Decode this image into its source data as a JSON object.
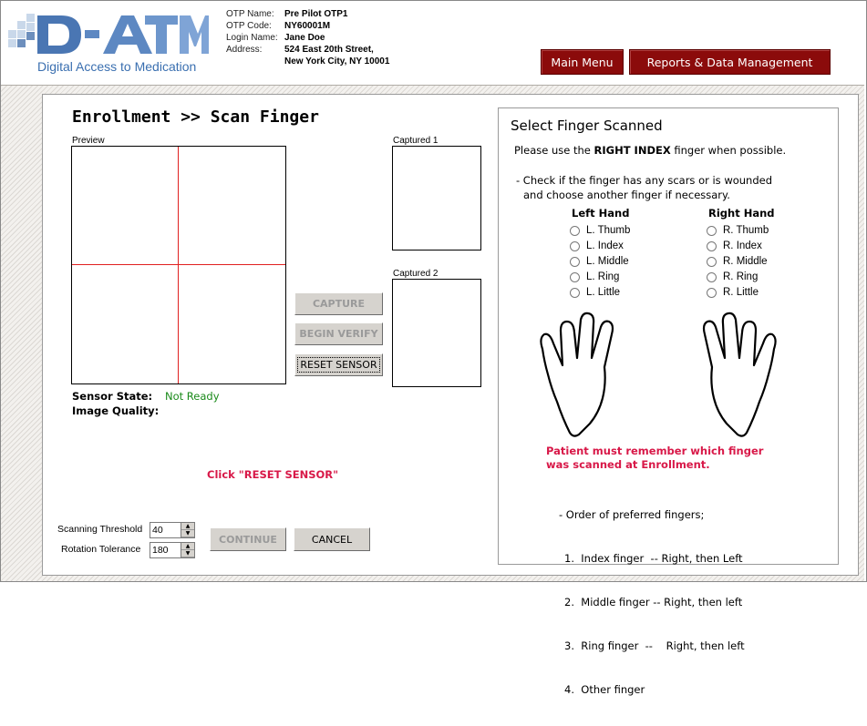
{
  "header": {
    "logo_text": "D-ATM",
    "logo_subtitle": "Digital Access to Medication",
    "info": [
      {
        "key": "OTP Name:",
        "value": "Pre Pilot OTP1"
      },
      {
        "key": "OTP Code:",
        "value": "NY60001M"
      },
      {
        "key": "Login Name:",
        "value": "Jane Doe"
      },
      {
        "key": "Address:",
        "value": "524 East 20th Street,"
      },
      {
        "key": "",
        "value": "New York City, NY 10001"
      }
    ],
    "main_menu_label": "Main Menu",
    "reports_label": "Reports & Data Management",
    "button_color": "#8b0b0b"
  },
  "enroll": {
    "title": "Enrollment >> Scan Finger",
    "preview_label": "Preview",
    "captured1_label": "Captured 1",
    "captured2_label": "Captured 2",
    "capture_label": "CAPTURE",
    "begin_verify_label": "BEGIN VERIFY",
    "reset_sensor_label": "RESET SENSOR",
    "sensor_state_label": "Sensor State:",
    "sensor_state_value": "Not Ready",
    "image_quality_label": "Image Quality:",
    "click_msg": "Click \"RESET SENSOR\"",
    "scanning_threshold_label": "Scanning Threshold",
    "scanning_threshold_value": "40",
    "rotation_tolerance_label": "Rotation Tolerance",
    "rotation_tolerance_value": "180",
    "continue_label": "CONTINUE",
    "cancel_label": "CANCEL"
  },
  "select": {
    "title": "Select Finger Scanned",
    "instruction_prefix": "Please use the ",
    "instruction_bold": "RIGHT INDEX",
    "instruction_suffix": " finger when possible.",
    "check_line1": "- Check if the finger has any scars or is wounded",
    "check_line2": "and choose another finger if necessary.",
    "left_hand_label": "Left Hand",
    "right_hand_label": "Right Hand",
    "left_fingers": [
      "L. Thumb",
      "L. Index",
      "L. Middle",
      "L. Ring",
      "L. Little"
    ],
    "right_fingers": [
      "R. Thumb",
      "R. Index",
      "R. Middle",
      "R. Ring",
      "R. Little"
    ],
    "warning_line1": "Patient must remember which finger",
    "warning_line2": "was scanned at Enrollment.",
    "order_title": "- Order of preferred fingers;",
    "order_lines": [
      "1.  Index finger  -- Right, then Left",
      "2.  Middle finger -- Right, then left",
      "3.  Ring finger  --    Right, then left",
      "4.  Other finger"
    ]
  }
}
